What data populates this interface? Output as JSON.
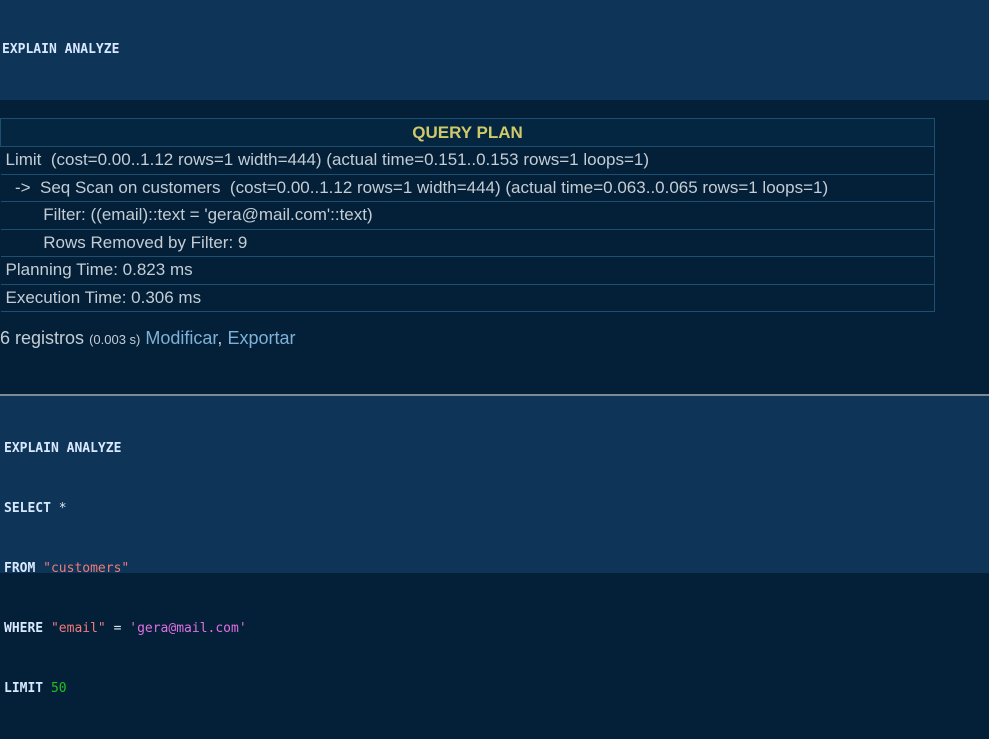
{
  "query_lines": {
    "line1": {
      "kw": "EXPLAIN ANALYZE"
    },
    "line2": {
      "kw": "SELECT",
      "rest": " *"
    },
    "line3": {
      "kw": "FROM",
      "ident": "\"customers\""
    },
    "line4": {
      "kw": "WHERE",
      "ident": "\"email\"",
      "op": " = ",
      "str": "'gera@mail.com'"
    },
    "line5": {
      "kw": "LIMIT",
      "num": "50"
    }
  },
  "plan": {
    "header": "QUERY PLAN",
    "rows": [
      "Limit  (cost=0.00..1.12 rows=1 width=444) (actual time=0.151..0.153 rows=1 loops=1)",
      "  ->  Seq Scan on customers  (cost=0.00..1.12 rows=1 width=444) (actual time=0.063..0.065 rows=1 loops=1)",
      "        Filter: ((email)::text = 'gera@mail.com'::text)",
      "        Rows Removed by Filter: 9",
      "Planning Time: 0.823 ms",
      "Execution Time: 0.306 ms"
    ]
  },
  "result_info": {
    "count": "6 registros",
    "time": "(0.003 s)",
    "modify_link": "Modificar",
    "separator": ",",
    "export_link": "Exportar"
  },
  "colors": {
    "editor_bg": "#0e3557",
    "page_bg": "#032038",
    "keyword": "#d8e8ff",
    "identifier": "#f07a7a",
    "string": "#e070e0",
    "number": "#22c022",
    "plan_header": "#cfc96a",
    "link": "#7fb0d8"
  }
}
